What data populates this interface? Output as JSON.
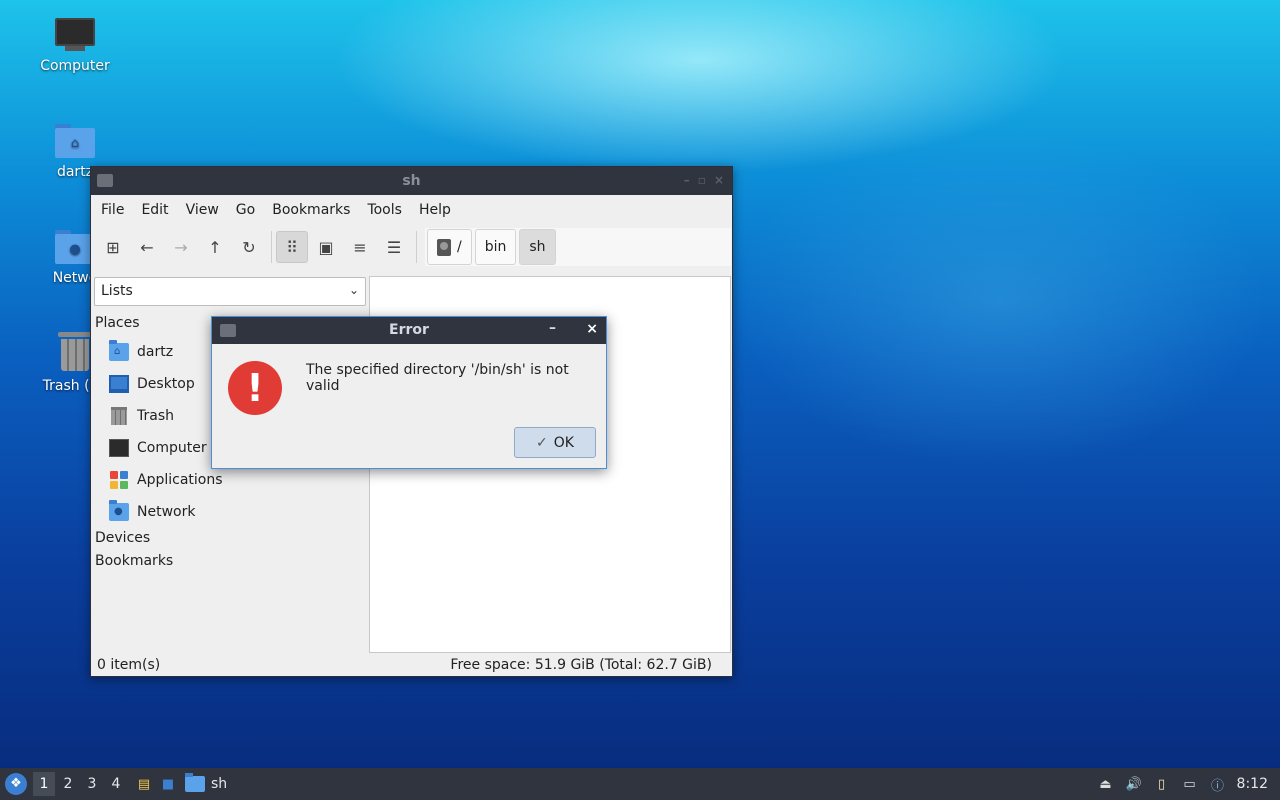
{
  "desktop": {
    "icons": [
      {
        "label": "Computer",
        "icon": "monitor-icon"
      },
      {
        "label": "dartz",
        "icon": "home-folder-icon"
      },
      {
        "label": "Netwo",
        "icon": "network-folder-icon"
      },
      {
        "label": "Trash (En",
        "icon": "trash-icon"
      }
    ]
  },
  "window": {
    "title": "sh",
    "menu": [
      "File",
      "Edit",
      "View",
      "Go",
      "Bookmarks",
      "Tools",
      "Help"
    ],
    "path": [
      "/",
      "bin",
      "sh"
    ],
    "side": {
      "combo": "Lists",
      "places_header": "Places",
      "places": [
        "dartz",
        "Desktop",
        "Trash",
        "Computer",
        "Applications",
        "Network"
      ],
      "devices_header": "Devices",
      "bookmarks_header": "Bookmarks"
    },
    "status": {
      "items": "0 item(s)",
      "free": "Free space: 51.9 GiB (Total: 62.7 GiB)"
    }
  },
  "dialog": {
    "title": "Error",
    "message": "The specified directory '/bin/sh' is not valid",
    "ok": "OK",
    "minimize": "–",
    "close": "×"
  },
  "taskbar": {
    "workspaces": [
      "1",
      "2",
      "3",
      "4"
    ],
    "task": "sh",
    "clock": "8:12"
  },
  "colors": {
    "titlebar": "#2f343f",
    "accent": "#4a90d9",
    "error": "#e03b35"
  }
}
